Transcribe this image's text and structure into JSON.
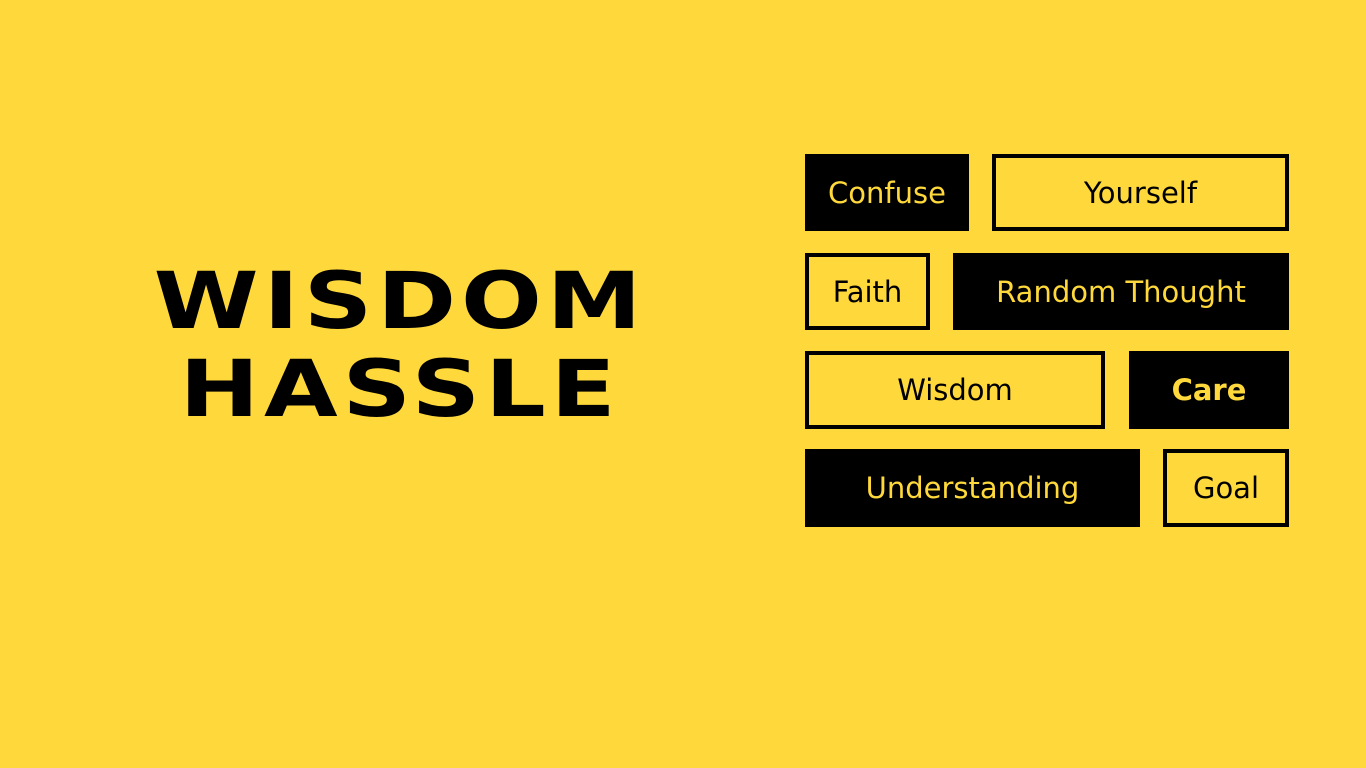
{
  "title": {
    "line1": "WISDOM",
    "line2": "HASSLE"
  },
  "tags": {
    "confuse": "Confuse",
    "yourself": "Yourself",
    "faith": "Faith",
    "random_thought": "Random Thought",
    "wisdom": "Wisdom",
    "care": "Care",
    "understanding": "Understanding",
    "goal": "Goal"
  },
  "colors": {
    "background": "#FFD93B",
    "ink": "#000000"
  }
}
